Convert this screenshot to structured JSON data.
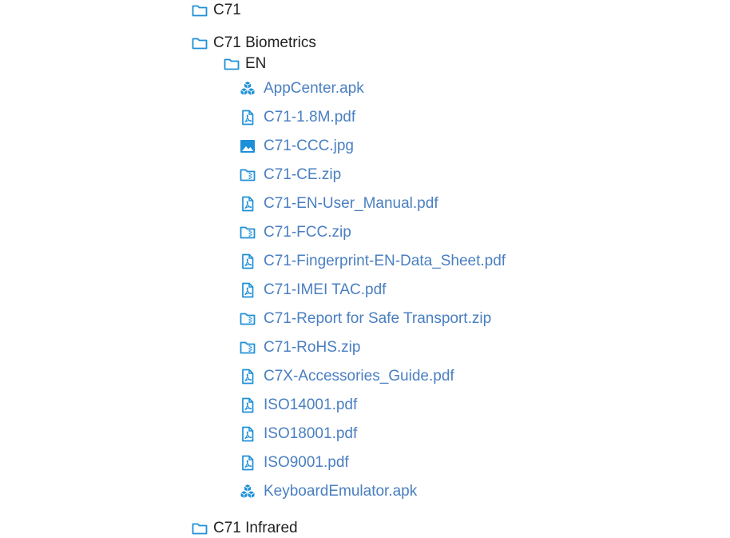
{
  "tree": {
    "folders": {
      "c71": "C71",
      "c71_biometrics": "C71 Biometrics",
      "en": "EN",
      "c71_infrared": "C71 Infrared"
    },
    "files": [
      {
        "name": "AppCenter.apk",
        "icon": "package-icon"
      },
      {
        "name": "C71-1.8M.pdf",
        "icon": "pdf-icon"
      },
      {
        "name": "C71-CCC.jpg",
        "icon": "image-icon"
      },
      {
        "name": "C71-CE.zip",
        "icon": "zip-folder-icon"
      },
      {
        "name": "C71-EN-User_Manual.pdf",
        "icon": "pdf-icon"
      },
      {
        "name": "C71-FCC.zip",
        "icon": "zip-folder-icon"
      },
      {
        "name": "C71-Fingerprint-EN-Data_Sheet.pdf",
        "icon": "pdf-icon"
      },
      {
        "name": "C71-IMEI TAC.pdf",
        "icon": "pdf-icon"
      },
      {
        "name": "C71-Report for Safe Transport.zip",
        "icon": "zip-folder-icon"
      },
      {
        "name": "C71-RoHS.zip",
        "icon": "zip-folder-icon"
      },
      {
        "name": "C7X-Accessories_Guide.pdf",
        "icon": "pdf-icon"
      },
      {
        "name": "ISO14001.pdf",
        "icon": "pdf-icon"
      },
      {
        "name": "ISO18001.pdf",
        "icon": "pdf-icon"
      },
      {
        "name": "ISO9001.pdf",
        "icon": "pdf-icon"
      },
      {
        "name": "KeyboardEmulator.apk",
        "icon": "package-icon"
      }
    ]
  },
  "colors": {
    "icon": "#1e90d8",
    "link": "#4a7fc1",
    "folder_text": "#222222"
  }
}
